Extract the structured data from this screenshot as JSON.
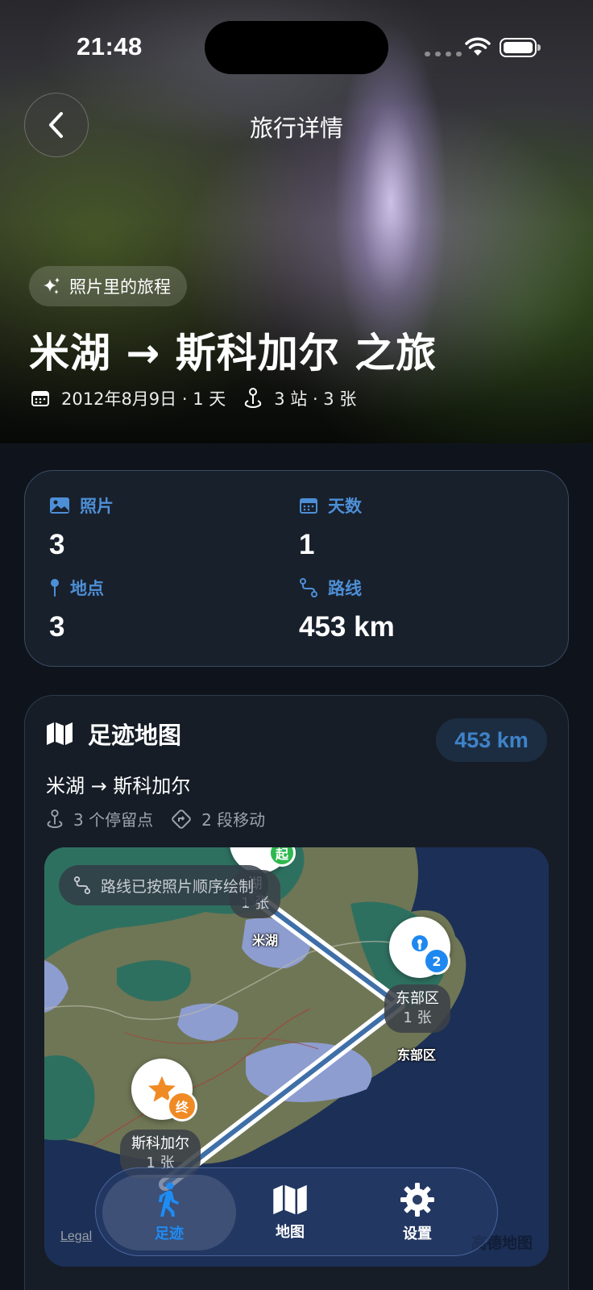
{
  "status_bar": {
    "time": "21:48"
  },
  "nav": {
    "title": "旅行详情",
    "back_icon": "chevron-left-icon"
  },
  "hero": {
    "chip_label": "照片里的旅程",
    "title": "米湖 → 斯科加尔 之旅",
    "date": "2012年8月9日 · 1 天",
    "stops": "3 站 · 3 张"
  },
  "stats": [
    {
      "icon": "photo-icon",
      "label": "照片",
      "value": "3"
    },
    {
      "icon": "calendar-icon",
      "label": "天数",
      "value": "1"
    },
    {
      "icon": "pin-icon",
      "label": "地点",
      "value": "3"
    },
    {
      "icon": "route-icon",
      "label": "路线",
      "value": "453 km"
    }
  ],
  "footprint_map": {
    "title": "足迹地图",
    "distance": "453 km",
    "route_name": "米湖 → 斯科加尔",
    "stop_count": "3 个停留点",
    "segment_count": "2 段移动",
    "note": "路线已按照片顺序绘制",
    "legal": "Legal",
    "provider": "高德地图",
    "markers": [
      {
        "badge": "起",
        "label_name": "湖",
        "label_count": "1 张",
        "place": "米湖"
      },
      {
        "badge": "2",
        "label_name": "东部区",
        "label_count": "1 张",
        "place": "东部区"
      },
      {
        "badge": "终",
        "label_name": "斯科加尔",
        "label_count": "1 张",
        "place": ""
      }
    ]
  },
  "tabs": [
    {
      "label": "足迹",
      "icon": "walking-icon",
      "active": true
    },
    {
      "label": "地图",
      "icon": "map-icon",
      "active": false
    },
    {
      "label": "设置",
      "icon": "gear-icon",
      "active": false
    }
  ],
  "colors": {
    "accent": "#1d8cf5",
    "stat_label": "#4d8fd6",
    "start_badge": "#2fb84f",
    "stop_badge": "#1e88f0",
    "end_badge": "#f08a24",
    "route": "#3f6fa8"
  }
}
